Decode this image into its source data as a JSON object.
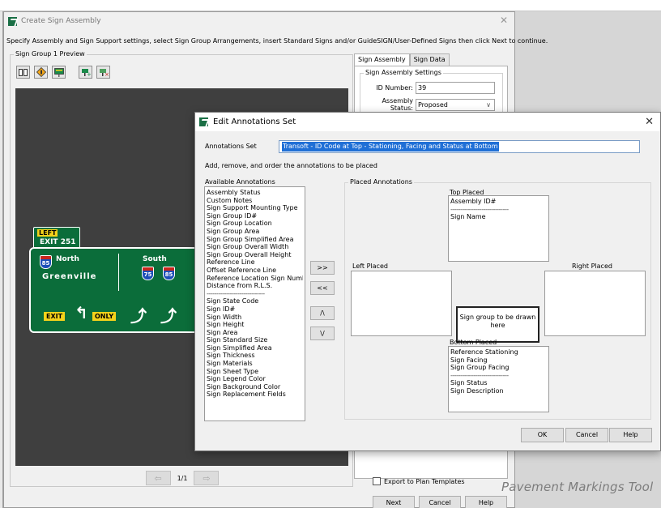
{
  "watermark": "Pavement Markings Tool",
  "main_window": {
    "title": "Create Sign Assembly",
    "instructions": "Specify Assembly and Sign Support settings, select Sign Group Arrangements, insert Standard Signs and/or GuideSIGN/User-Defined Signs then click Next to continue.",
    "preview_group_label": "Sign Group 1 Preview",
    "pager": {
      "label": "1/1",
      "prev": "⇦",
      "next": "⇨"
    },
    "tabs": [
      {
        "label": "Sign Assembly",
        "active": true
      },
      {
        "label": "Sign Data",
        "active": false
      }
    ],
    "settings": {
      "group_label": "Sign Assembly Settings",
      "id_label": "ID Number:",
      "id_value": "39",
      "status_label": "Assembly Status:",
      "status_value": "Proposed"
    },
    "export_label": "Export to Plan Templates",
    "buttons": {
      "next": "Next",
      "cancel": "Cancel",
      "help": "Help"
    }
  },
  "sign": {
    "exit_tab": {
      "left_label": "LEFT",
      "exit_text": "EXIT 251"
    },
    "left_panel": {
      "shield": "85",
      "direction": "North",
      "city": "Greenville"
    },
    "right_panel": {
      "direction": "South",
      "shields": [
        "75",
        "85"
      ]
    },
    "bottom": {
      "exit_label": "EXIT",
      "only_label": "ONLY"
    }
  },
  "dialog": {
    "title": "Edit Annotations Set",
    "annotations_set_label": "Annotations Set",
    "annotations_set_value": "Transoft - ID Code at Top - Stationing, Facing and Status at Bottom",
    "instructions": "Add, remove, and order the annotations to be placed",
    "available_label": "Available Annotations",
    "available_items": [
      "Assembly Status",
      "Custom Notes",
      "Sign Support Mounting Type",
      "Sign Group ID#",
      "Sign Group Location",
      "Sign Group Area",
      "Sign Group Simplified Area",
      "Sign Group Overall Width",
      "Sign Group Overall Height",
      "Reference Line",
      "Offset Reference Line",
      "Reference Location Sign Number",
      "Distance from R.L.S.",
      "------------------------------",
      "Sign State Code",
      "Sign ID#",
      "Sign Width",
      "Sign Height",
      "Sign Area",
      "Sign Standard Size",
      "Sign Simplified Area",
      "Sign Thickness",
      "Sign Materials",
      "Sign Sheet Type",
      "Sign Legend Color",
      "Sign Background Color",
      "Sign Replacement Fields"
    ],
    "move_buttons": {
      "add": ">>",
      "remove": "<<",
      "up": "/\\",
      "down": "\\/"
    },
    "placed_label": "Placed Annotations",
    "top_placed": {
      "label": "Top Placed",
      "items": [
        "Assembly ID#",
        "------------------------------",
        "Sign Name"
      ]
    },
    "left_placed": {
      "label": "Left  Placed",
      "items": []
    },
    "right_placed": {
      "label": "Right Placed",
      "items": []
    },
    "sign_group_placeholder": "Sign group to be drawn here",
    "bottom_placed": {
      "label": "Bottom Placed",
      "items": [
        "Reference Stationing",
        "Sign Facing",
        "Sign Group Facing",
        "------------------------------",
        "Sign Status",
        "Sign Description"
      ]
    },
    "buttons": {
      "ok": "OK",
      "cancel": "Cancel",
      "help": "Help"
    }
  },
  "colors": {
    "sign_green": "#0b6d3a",
    "sign_yellow": "#f4d21a",
    "shield_blue": "#1d4fb8",
    "shield_red": "#c8261d",
    "selection_blue": "#1f6fd6",
    "app_icon": "#1a6f45"
  }
}
